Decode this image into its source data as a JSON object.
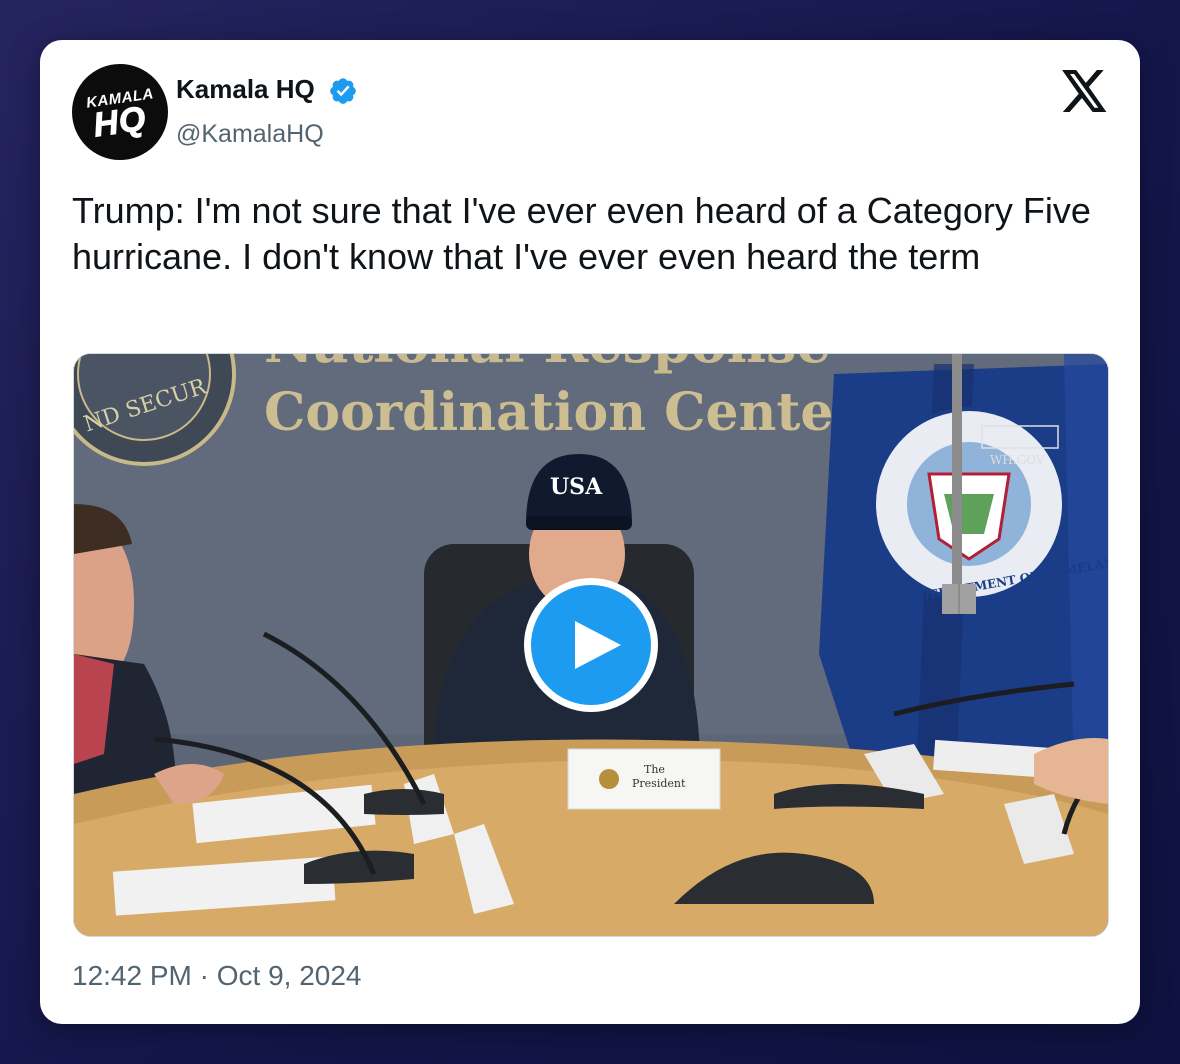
{
  "author": {
    "display_name": "Kamala HQ",
    "handle": "@KamalaHQ",
    "avatar_top": "KAMALA",
    "avatar_bottom": "HQ",
    "verified": true,
    "verified_color": "#1d9bf0"
  },
  "tweet": {
    "text": "Trump: I'm not sure that I've ever even heard of a Category Five hurricane. I don't know that I've ever even heard the term",
    "timestamp": "12:42 PM · Oct 9, 2024"
  },
  "media": {
    "type": "video",
    "wall_text_top": "National Response",
    "wall_text": "Coordination Center",
    "seal_text": "ND SECUR",
    "hat_text": "USA",
    "placard_line1": "The",
    "placard_line2": "President",
    "flag_text": "U.S. DEPARTMENT OF HOMELAND SECURITY",
    "watermark": "WH.GOV",
    "play_icon": "play-icon"
  },
  "icons": {
    "brand": "x-logo-icon",
    "verified": "verified-badge-icon"
  },
  "colors": {
    "background_top": "#25245f",
    "background_bottom": "#0f1240",
    "accent": "#1d9bf0",
    "text_primary": "#0f1419",
    "text_secondary": "#536471"
  }
}
